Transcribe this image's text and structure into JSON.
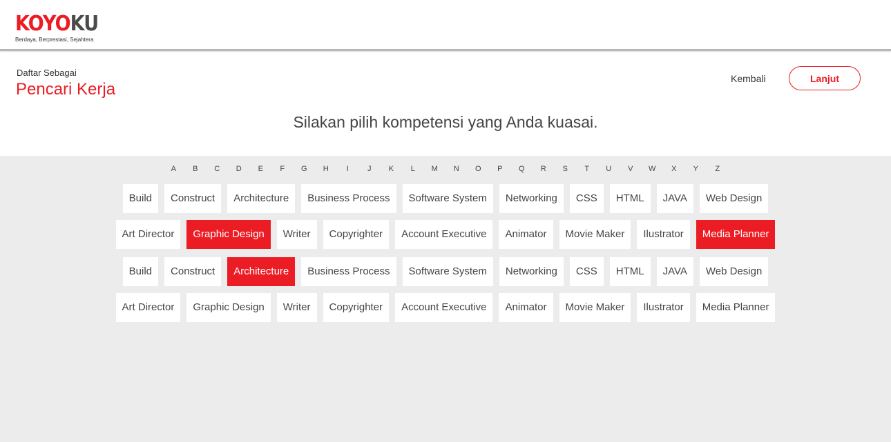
{
  "header": {
    "logo_red": "KOYO",
    "logo_grey": "KU",
    "tagline": "Berdaya, Berprestasi, Sejahtera"
  },
  "registration": {
    "label": "Daftar Sebagai",
    "role": "Pencari Kerja"
  },
  "actions": {
    "back_label": "Kembali",
    "next_label": "Lanjut"
  },
  "instruction": "Silakan pilih kompetensi yang Anda kuasai.",
  "alphabet": [
    "A",
    "B",
    "C",
    "D",
    "E",
    "F",
    "G",
    "H",
    "I",
    "J",
    "K",
    "L",
    "M",
    "N",
    "O",
    "P",
    "Q",
    "R",
    "S",
    "T",
    "U",
    "V",
    "W",
    "X",
    "Y",
    "Z"
  ],
  "competency_rows": [
    [
      {
        "label": "Build",
        "selected": false
      },
      {
        "label": "Construct",
        "selected": false
      },
      {
        "label": "Architecture",
        "selected": false
      },
      {
        "label": "Business Process",
        "selected": false
      },
      {
        "label": "Software System",
        "selected": false
      },
      {
        "label": "Networking",
        "selected": false
      },
      {
        "label": "CSS",
        "selected": false
      },
      {
        "label": "HTML",
        "selected": false
      },
      {
        "label": "JAVA",
        "selected": false
      },
      {
        "label": "Web Design",
        "selected": false
      }
    ],
    [
      {
        "label": "Art Director",
        "selected": false
      },
      {
        "label": "Graphic Design",
        "selected": true
      },
      {
        "label": "Writer",
        "selected": false
      },
      {
        "label": "Copyrighter",
        "selected": false
      },
      {
        "label": "Account Executive",
        "selected": false
      },
      {
        "label": "Animator",
        "selected": false
      },
      {
        "label": "Movie Maker",
        "selected": false
      },
      {
        "label": "Ilustrator",
        "selected": false
      },
      {
        "label": "Media Planner",
        "selected": true
      }
    ],
    [
      {
        "label": "Build",
        "selected": false
      },
      {
        "label": "Construct",
        "selected": false
      },
      {
        "label": "Architecture",
        "selected": true
      },
      {
        "label": "Business Process",
        "selected": false
      },
      {
        "label": "Software System",
        "selected": false
      },
      {
        "label": "Networking",
        "selected": false
      },
      {
        "label": "CSS",
        "selected": false
      },
      {
        "label": "HTML",
        "selected": false
      },
      {
        "label": "JAVA",
        "selected": false
      },
      {
        "label": "Web Design",
        "selected": false
      }
    ],
    [
      {
        "label": "Art Director",
        "selected": false
      },
      {
        "label": "Graphic Design",
        "selected": false
      },
      {
        "label": "Writer",
        "selected": false
      },
      {
        "label": "Copyrighter",
        "selected": false
      },
      {
        "label": "Account Executive",
        "selected": false
      },
      {
        "label": "Animator",
        "selected": false
      },
      {
        "label": "Movie Maker",
        "selected": false
      },
      {
        "label": "Ilustrator",
        "selected": false
      },
      {
        "label": "Media Planner",
        "selected": false
      }
    ]
  ],
  "colors": {
    "accent": "#ec1c24",
    "panel_bg": "#ececec",
    "logo_grey": "#4b4b4b"
  }
}
